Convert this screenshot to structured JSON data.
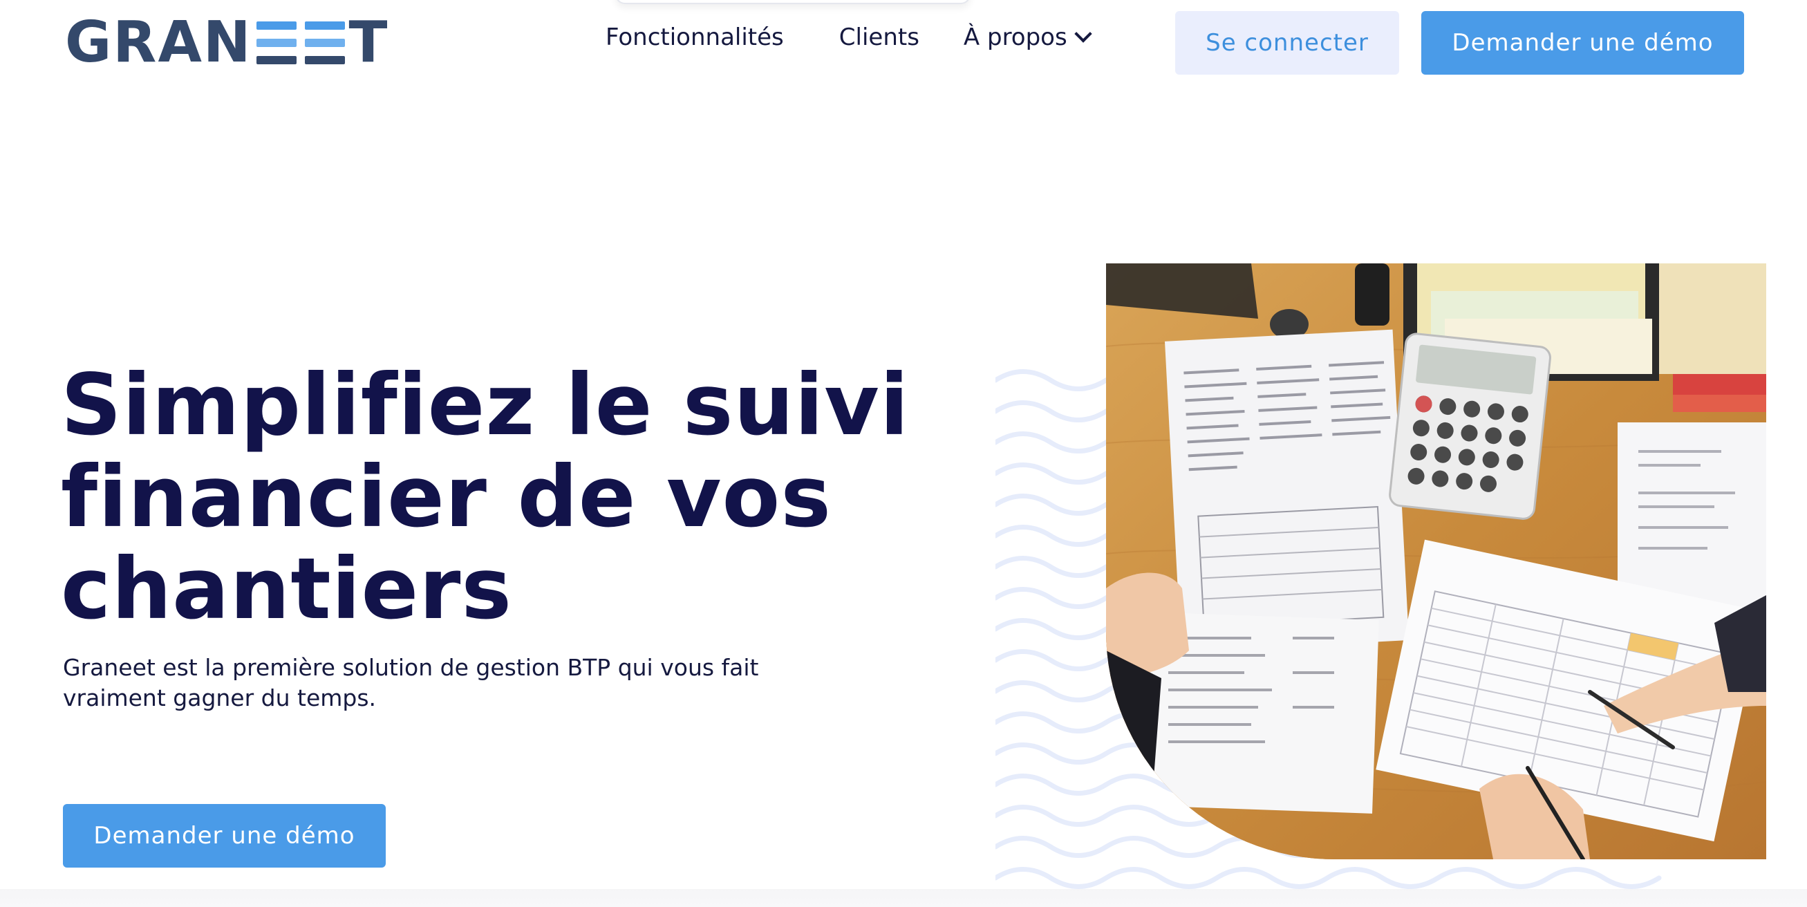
{
  "header": {
    "logo_text_left": "GRAN",
    "logo_text_right": "T",
    "nav": [
      {
        "label": "Fonctionnalités"
      },
      {
        "label": "Clients"
      },
      {
        "label": "À propos"
      }
    ],
    "login_label": "Se connecter",
    "demo_label": "Demander une démo"
  },
  "hero": {
    "title_line1": "Simplifiez le suivi",
    "title_line2": "financier de vos",
    "title_line3": "chantiers",
    "subtitle_line1": "Graneet est la première solution de gestion BTP qui vous fait",
    "subtitle_line2": "vraiment gagner du temps.",
    "cta_label": "Demander une démo"
  },
  "colors": {
    "brand_dark": "#34496b",
    "brand_blue": "#4a9be8",
    "title": "#12134a",
    "login_bg": "#eaeefd",
    "logo_bar_light": "#6fb0ee",
    "logo_bar_mid": "#4a9be8",
    "logo_bar_dark": "#34496b"
  },
  "icons": {
    "dropdown": "chevron-down-icon"
  }
}
